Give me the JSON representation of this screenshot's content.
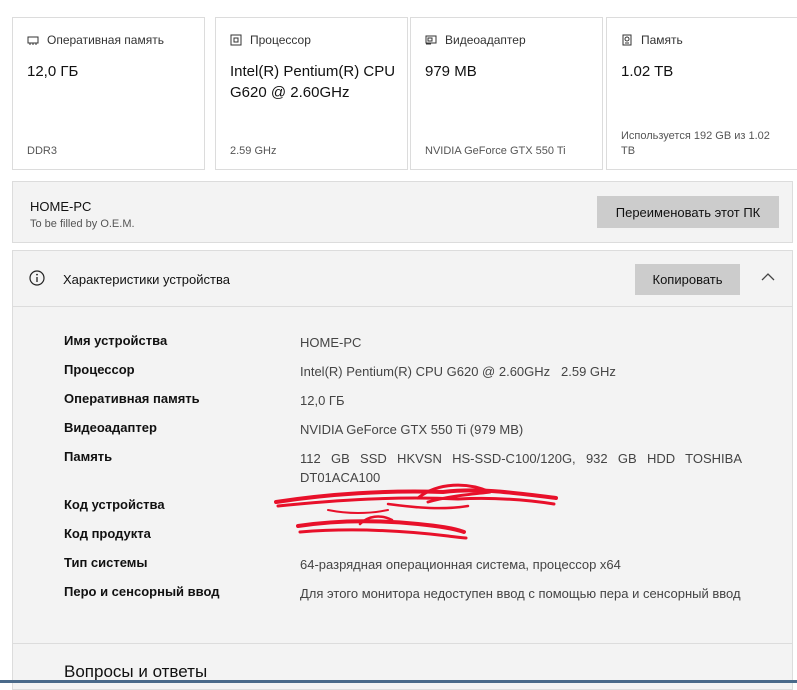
{
  "cards": [
    {
      "title": "Оперативная память",
      "icon": "memory-icon",
      "value": "12,0 ГБ",
      "sub": "DDR3"
    },
    {
      "title": "Процессор",
      "icon": "processor-icon",
      "value": "Intel(R) Pentium(R) CPU G620 @ 2.60GHz",
      "sub": "2.59 GHz"
    },
    {
      "title": "Видеоадаптер",
      "icon": "gpu-icon",
      "value": "979 MB",
      "sub": "NVIDIA GeForce GTX 550 Ti"
    },
    {
      "title": "Память",
      "icon": "storage-icon",
      "value": "1.02 TB",
      "sub": "Используется 192 GB из 1.02 TB"
    }
  ],
  "pc": {
    "name": "HOME-PC",
    "oem": "To be filled by O.E.M.",
    "rename_label": "Переименовать этот ПК"
  },
  "specs": {
    "title": "Характеристики устройства",
    "copy_label": "Копировать",
    "rows": [
      {
        "label": "Имя устройства",
        "value": "HOME-PC"
      },
      {
        "label": "Процессор",
        "value": "Intel(R) Pentium(R) CPU G620 @ 2.60GHz   2.59 GHz"
      },
      {
        "label": "Оперативная память",
        "value": "12,0 ГБ"
      },
      {
        "label": "Видеоадаптер",
        "value": "NVIDIA GeForce GTX 550 Ti (979 MB)"
      },
      {
        "label": "Память",
        "value": "112 GB SSD HKVSN HS-SSD-C100/120G, 932 GB HDD TOSHIBA DT01ACA100"
      },
      {
        "label": "Код устройства",
        "value": ""
      },
      {
        "label": "Код продукта",
        "value": ""
      },
      {
        "label": "Тип системы",
        "value": "64-разрядная операционная система, процессор x64"
      },
      {
        "label": "Перо и сенсорный ввод",
        "value": "Для этого монитора недоступен ввод с помощью пера и сенсорный ввод"
      }
    ]
  },
  "faq": {
    "title": "Вопросы и ответы"
  },
  "colors": {
    "button": "#cccccc",
    "panel": "#f3f3f3",
    "redaction": "#e8102a"
  }
}
